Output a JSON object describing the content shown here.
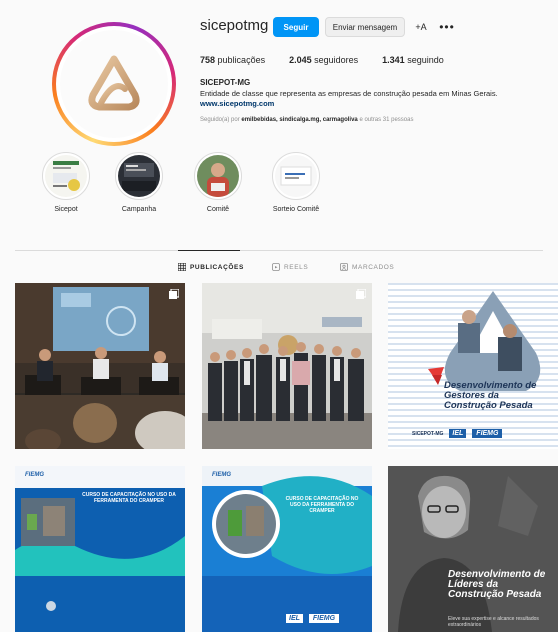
{
  "profile": {
    "username": "sicepotmg",
    "follow_label": "Seguir",
    "message_label": "Enviar mensagem",
    "suggest_icon": "+A",
    "more_icon": "•••",
    "posts_count": "758",
    "posts_label": "publicações",
    "followers_count": "2.045",
    "followers_label": "seguidores",
    "following_count": "1.341",
    "following_label": "seguindo",
    "name": "SICEPOT-MG",
    "bio": "Entidade de classe que representa as empresas de construção pesada em Minas Gerais.",
    "link": "www.sicepotmg.com",
    "followed_by_prefix": "Seguido(a) por",
    "followed_by_names": "emilbebidas, sindicalga.mg, carmagoliva",
    "followed_by_suffix": "e outras 31 pessoas"
  },
  "highlights": [
    {
      "label": "Sicepot"
    },
    {
      "label": "Campanha"
    },
    {
      "label": "Comitê"
    },
    {
      "label": "Sorteio Comitê"
    }
  ],
  "tabs": [
    {
      "label": "PUBLICAÇÕES",
      "icon": "grid-icon"
    },
    {
      "label": "REELS",
      "icon": "reels-icon"
    },
    {
      "label": "MARCADOS",
      "icon": "tagged-icon"
    }
  ],
  "posts": {
    "p3_title": "Desenvolvimento de Gestores da Construção Pesada",
    "p3_logo_sicepot": "SICEPOT-MG",
    "p3_logo_iel": "IEL",
    "p3_logo_fiemg": "FIEMG",
    "p4_brand": "FIEMG",
    "p4_title": "CURSO DE CAPACITAÇÃO NO USO DA FERRAMENTA DO CRAMPER",
    "p5_brand": "FIEMG",
    "p5_title": "CURSO DE CAPACITAÇÃO NO USO DA FERRAMENTA DO CRAMPER",
    "p5_logo_iel": "IEL",
    "p5_logo_fiemg": "FIEMG",
    "p6_title": "Desenvolvimento de Líderes da Construção Pesada",
    "p6_sub": "Eleve sua expertise e alcance resultados extraordinários"
  },
  "colors": {
    "accent": "#0095f6",
    "brand_blue": "#1d5fa8",
    "teal": "#1ec6c0"
  }
}
